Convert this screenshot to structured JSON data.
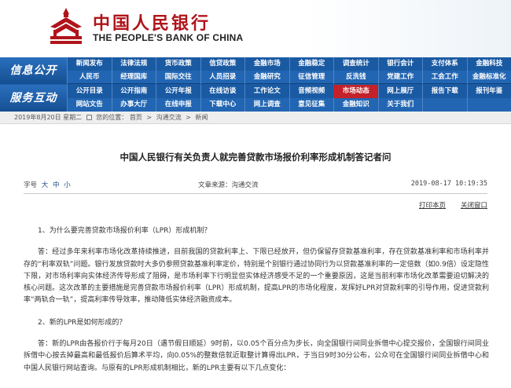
{
  "header": {
    "brand_cn": "中国人民银行",
    "brand_en": "THE PEOPLE'S BANK OF CHINA",
    "logo_icon": "pboc-emblem-icon",
    "brand_color": "#b0141a"
  },
  "nav": {
    "label_info": "信息公开",
    "label_service": "服务互动",
    "rows": [
      [
        "新闻发布",
        "法律法规",
        "货币政策",
        "信贷政策",
        "金融市场",
        "金融稳定",
        "调查统计",
        "银行会计",
        "支付体系",
        "金融科技"
      ],
      [
        "人民币",
        "经理国库",
        "国际交往",
        "人员招录",
        "金融研究",
        "征信管理",
        "反洗钱",
        "党建工作",
        "工会工作",
        "金融标准化"
      ],
      [
        "公开目录",
        "公开指南",
        "公开年报",
        "在线访谈",
        "工作论文",
        "音频视频",
        "市场动态",
        "网上展厅",
        "报告下载",
        "报刊年鉴"
      ],
      [
        "网站文告",
        "办事大厅",
        "在线申报",
        "下载中心",
        "网上调查",
        "意见征集",
        "金融知识",
        "关于我们",
        "",
        ""
      ]
    ],
    "highlight": "市场动态",
    "accent": "#1d5ea8",
    "highlight_color": "#c3222a"
  },
  "breadcrumb": {
    "date": "2019年8月20日 星期二",
    "current_location": "您的位置：",
    "home": "首页",
    "section": "沟通交流",
    "page": "新闻"
  },
  "article": {
    "title": "中国人民银行有关负责人就完善贷款市场报价利率形成机制答记者问",
    "font_size_label": "字号",
    "font_sizes": [
      "大",
      "中",
      "小"
    ],
    "source": "文章来源：沟通交流",
    "date": "2019-08-17 10:19:35",
    "print": "打印本页",
    "close": "关闭窗口",
    "paragraphs": [
      "1、为什么要完善贷款市场报价利率（LPR）形成机制？",
      "答：经过多年来利率市场化改革持续推进，目前我国的贷款利率上、下限已经放开，但仍保留存贷款基准利率，存在贷款基准利率和市场利率并存的“利率双轨”问题。银行发放贷款时大多仍参照贷款基准利率定价，特别是个别银行通过协同行为以贷款基准利率的一定倍数（如0.9倍）设定隐性下限，对市场利率向实体经济传导形成了阻碍，是市场利率下行明显但实体经济感受不足的一个重要原因，这是当前利率市场化改革需要迫切解决的核心问题。这次改革的主要措施是完善贷款市场报价利率（LPR）形成机制，提高LPR的市场化程度，发挥好LPR对贷款利率的引导作用，促进贷款利率“两轨合一轨”，提高利率传导效率，推动降低实体经济融资成本。",
      "2、新的LPR是如何形成的？",
      "答：新的LPR由各报价行于每月20日（遇节假日顺延）9时前，以0.05个百分点为步长，向全国银行间同业拆借中心提交报价，全国银行间同业拆借中心按去掉最高和最低报价后算术平均，向0.05%的整数倍就近取整计算得出LPR，于当日9时30分公布，公众可在全国银行间同业拆借中心和中国人民银行网站查询。与原有的LPR形成机制相比，新的LPR主要有以下几点变化："
    ]
  }
}
